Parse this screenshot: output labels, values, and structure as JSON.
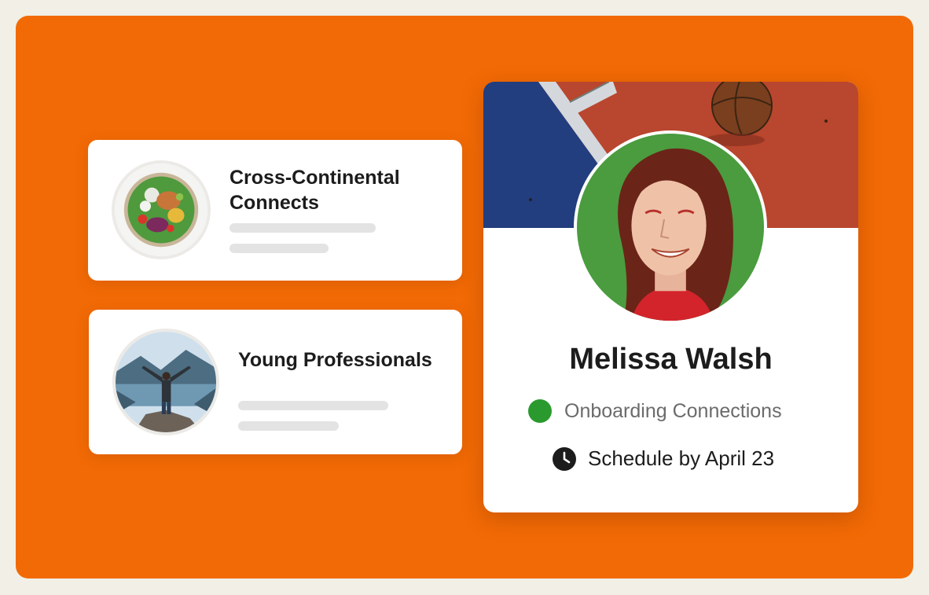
{
  "colors": {
    "background": "#f26a05",
    "status_online": "#2a9a2f"
  },
  "groups": [
    {
      "title": "Cross-Continental Connects",
      "image": "salad-bowl-photo"
    },
    {
      "title": "Young Professionals",
      "image": "hiker-on-cliff-photo"
    }
  ],
  "profile": {
    "name": "Melissa Walsh",
    "status": "Onboarding Connections",
    "status_icon": "green-dot",
    "schedule": "Schedule by April 23",
    "schedule_icon": "clock-icon",
    "cover_image": "basketball-court-photo",
    "avatar_image": "smiling-woman-photo"
  }
}
